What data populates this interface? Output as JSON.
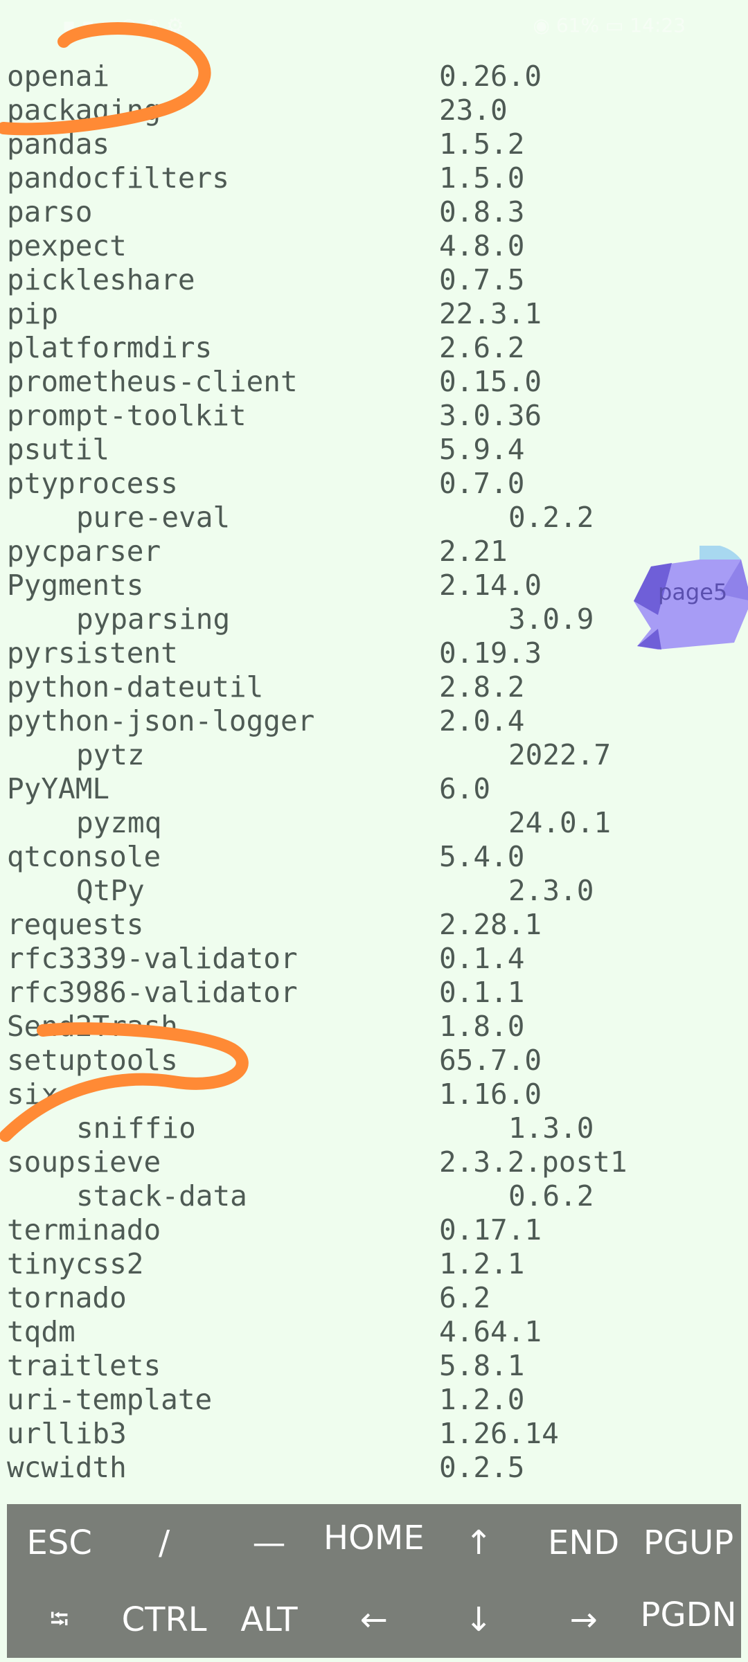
{
  "status_bar": {
    "left_text": "▪ ▪ ▪ ◎ ◐ ⚙",
    "right_text": "◉ 61% ▭ 14:23"
  },
  "packages": [
    {
      "name": "openai",
      "version": "0.26.0",
      "indent": false
    },
    {
      "name": "packaging",
      "version": "23.0",
      "indent": false
    },
    {
      "name": "pandas",
      "version": "1.5.2",
      "indent": false
    },
    {
      "name": "pandocfilters",
      "version": "1.5.0",
      "indent": false
    },
    {
      "name": "parso",
      "version": "0.8.3",
      "indent": false
    },
    {
      "name": "pexpect",
      "version": "4.8.0",
      "indent": false
    },
    {
      "name": "pickleshare",
      "version": "0.7.5",
      "indent": false
    },
    {
      "name": "pip",
      "version": "22.3.1",
      "indent": false
    },
    {
      "name": "platformdirs",
      "version": "2.6.2",
      "indent": false
    },
    {
      "name": "prometheus-client",
      "version": "0.15.0",
      "indent": false
    },
    {
      "name": "prompt-toolkit",
      "version": "3.0.36",
      "indent": false
    },
    {
      "name": "psutil",
      "version": "5.9.4",
      "indent": false
    },
    {
      "name": "ptyprocess",
      "version": "0.7.0",
      "indent": false
    },
    {
      "name": "pure-eval",
      "version": "0.2.2",
      "indent": true
    },
    {
      "name": "pycparser",
      "version": "2.21",
      "indent": false
    },
    {
      "name": "Pygments",
      "version": "2.14.0",
      "indent": false
    },
    {
      "name": "pyparsing",
      "version": "3.0.9",
      "indent": true
    },
    {
      "name": "pyrsistent",
      "version": "0.19.3",
      "indent": false
    },
    {
      "name": "python-dateutil",
      "version": "2.8.2",
      "indent": false
    },
    {
      "name": "python-json-logger",
      "version": "2.0.4",
      "indent": false
    },
    {
      "name": "pytz",
      "version": "2022.7",
      "indent": true
    },
    {
      "name": "PyYAML",
      "version": "6.0",
      "indent": false
    },
    {
      "name": "pyzmq",
      "version": "24.0.1",
      "indent": true
    },
    {
      "name": "qtconsole",
      "version": "5.4.0",
      "indent": false
    },
    {
      "name": "QtPy",
      "version": "2.3.0",
      "indent": true
    },
    {
      "name": "requests",
      "version": "2.28.1",
      "indent": false
    },
    {
      "name": "rfc3339-validator",
      "version": "0.1.4",
      "indent": false
    },
    {
      "name": "rfc3986-validator",
      "version": "0.1.1",
      "indent": false
    },
    {
      "name": "Send2Trash",
      "version": "1.8.0",
      "indent": false
    },
    {
      "name": "setuptools",
      "version": "65.7.0",
      "indent": false
    },
    {
      "name": "six",
      "version": "1.16.0",
      "indent": false
    },
    {
      "name": "sniffio",
      "version": "1.3.0",
      "indent": true
    },
    {
      "name": "soupsieve",
      "version": "2.3.2.post1",
      "indent": false
    },
    {
      "name": "stack-data",
      "version": "0.6.2",
      "indent": true
    },
    {
      "name": "terminado",
      "version": "0.17.1",
      "indent": false
    },
    {
      "name": "tinycss2",
      "version": "1.2.1",
      "indent": false
    },
    {
      "name": "tornado",
      "version": "6.2",
      "indent": false
    },
    {
      "name": "tqdm",
      "version": "4.64.1",
      "indent": false
    },
    {
      "name": "traitlets",
      "version": "5.8.1",
      "indent": false
    },
    {
      "name": "uri-template",
      "version": "1.2.0",
      "indent": false
    },
    {
      "name": "urllib3",
      "version": "1.26.14",
      "indent": false
    },
    {
      "name": "wcwidth",
      "version": "0.2.5",
      "indent": false
    }
  ],
  "floating_bubble": {
    "label": "page5"
  },
  "annotation_color": "#ff8a35",
  "keyboard": {
    "row1": [
      {
        "label": "ESC",
        "icon": ""
      },
      {
        "label": "/",
        "icon": ""
      },
      {
        "label": "—",
        "icon": ""
      },
      {
        "label": "HOME",
        "icon": ""
      },
      {
        "label": "↑",
        "icon": "arrow-up-icon"
      },
      {
        "label": "END",
        "icon": ""
      },
      {
        "label": "PGUP",
        "icon": ""
      }
    ],
    "row2": [
      {
        "label": "⭾",
        "icon": "tab-icon"
      },
      {
        "label": "CTRL",
        "icon": ""
      },
      {
        "label": "ALT",
        "icon": ""
      },
      {
        "label": "←",
        "icon": "arrow-left-icon"
      },
      {
        "label": "↓",
        "icon": "arrow-down-icon"
      },
      {
        "label": "→",
        "icon": "arrow-right-icon"
      },
      {
        "label": "PGDN",
        "icon": ""
      }
    ]
  }
}
